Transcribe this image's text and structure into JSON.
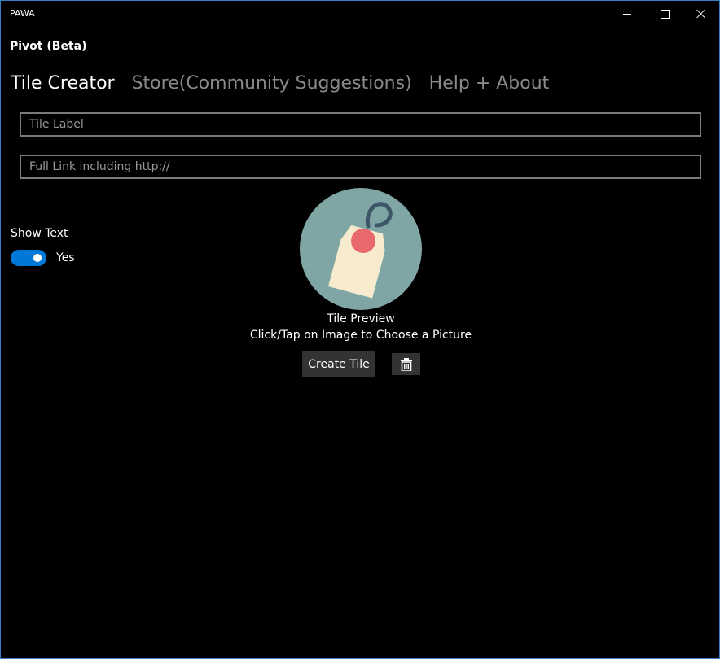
{
  "window": {
    "title": "PAWA",
    "accent": "#0078d7",
    "border_color": "#3c7fc6"
  },
  "header": {
    "pivot_title": "Pivot (Beta)"
  },
  "tabs": [
    {
      "label": "Tile Creator",
      "active": true
    },
    {
      "label": "Store(Community Suggestions)",
      "active": false
    },
    {
      "label": "Help + About",
      "active": false
    }
  ],
  "form": {
    "tile_label": {
      "value": "",
      "placeholder": "Tile Label"
    },
    "full_link": {
      "value": "",
      "placeholder": "Full Link including http://"
    }
  },
  "show_text": {
    "label": "Show Text",
    "state_label": "Yes",
    "on": true
  },
  "preview": {
    "icon": "tag-image",
    "caption": "Tile Preview",
    "hint": "Click/Tap on Image to Choose a Picture"
  },
  "actions": {
    "create_label": "Create Tile",
    "delete_icon": "trash-icon"
  }
}
